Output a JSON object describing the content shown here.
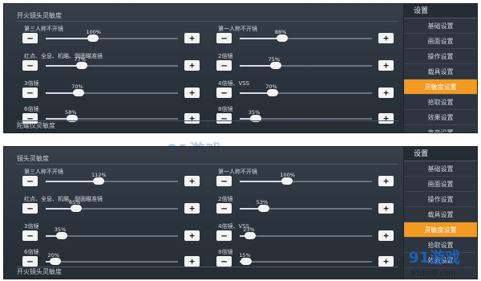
{
  "panels": [
    {
      "header": "开火镜头灵敏度",
      "footer": "陀螺仪灵敏度",
      "rows": [
        {
          "label": "第三人称不开镜",
          "value": "100%",
          "level": 0.36
        },
        {
          "label": "第一人称不开镜",
          "value": "88%",
          "level": 0.32
        },
        {
          "label": "红点、全息、机瞄、侧面瞄准镜",
          "value": "77%",
          "level": 0.27
        },
        {
          "label": "2倍镜",
          "value": "75%",
          "level": 0.27
        },
        {
          "label": "3倍镜",
          "value": "70%",
          "level": 0.25
        },
        {
          "label": "4倍镜、VSS",
          "value": "70%",
          "level": 0.25
        },
        {
          "label": "6倍镜",
          "value": "58%",
          "level": 0.2
        },
        {
          "label": "8倍镜",
          "value": "35%",
          "level": 0.12
        }
      ]
    },
    {
      "header": "镜头灵敏度",
      "footer": "开火镜头灵敏度",
      "rows": [
        {
          "label": "第三人称不开镜",
          "value": "112%",
          "level": 0.4
        },
        {
          "label": "第一人称不开镜",
          "value": "100%",
          "level": 0.36
        },
        {
          "label": "红点、全息、机瞄、侧面瞄准镜",
          "value": "65%",
          "level": 0.23
        },
        {
          "label": "2倍镜",
          "value": "53%",
          "level": 0.18
        },
        {
          "label": "3倍镜",
          "value": "35%",
          "level": 0.12
        },
        {
          "label": "4倍镜、VSS",
          "value": "23%",
          "level": 0.08
        },
        {
          "label": "6倍镜",
          "value": "20%",
          "level": 0.07
        },
        {
          "label": "8倍镜",
          "value": "15%",
          "level": 0.05
        }
      ]
    }
  ],
  "settings_menus": [
    {
      "title": "设置",
      "tabs": [
        "基础设置",
        "画面设置",
        "操作设置",
        "载具设置",
        "灵敏度设置",
        "拾取设置",
        "效果设置",
        "声音设置",
        "按键设置"
      ],
      "active_index": 4
    },
    {
      "title": "设置",
      "tabs": [
        "基础设置",
        "画面设置",
        "操作设置",
        "载具设置",
        "灵敏度设置",
        "拾取设置",
        "效果设置"
      ],
      "active_index": 4
    }
  ],
  "buttons": {
    "minus": "—",
    "plus": "+"
  },
  "watermarks": {
    "center": "91游戏",
    "corner_logo": "91游戏",
    "corner_site": "91danji.com"
  },
  "colors": {
    "active_tab": "#f29a21",
    "panel_bg": "#2b333c",
    "slider_fill": "#d6dce4",
    "logo": "#1f5fb7"
  },
  "icons": [
    "minus-icon",
    "plus-icon"
  ]
}
